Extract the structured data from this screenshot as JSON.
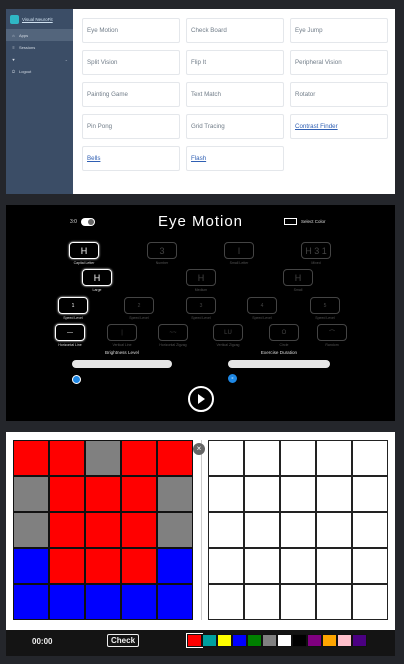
{
  "menu": {
    "app_name": "Visual NeuroFit",
    "nav": [
      {
        "label": "Apps",
        "icon": "home-icon"
      },
      {
        "label": "Sessions",
        "icon": "list-icon"
      },
      {
        "label": "",
        "icon": "heart-icon",
        "chevron": true
      },
      {
        "label": "Logout",
        "icon": "logout-icon"
      }
    ],
    "tiles": [
      {
        "label": "Eye Motion",
        "link": false
      },
      {
        "label": "Check Board",
        "link": false
      },
      {
        "label": "Eye Jump",
        "link": false
      },
      {
        "label": "Split Vision",
        "link": false
      },
      {
        "label": "Flip It",
        "link": false
      },
      {
        "label": "Peripheral Vision",
        "link": false
      },
      {
        "label": "Painting Game",
        "link": false
      },
      {
        "label": "Text Match",
        "link": false
      },
      {
        "label": "Rotator",
        "link": false
      },
      {
        "label": "Pin Pong",
        "link": false
      },
      {
        "label": "Grid Tracing",
        "link": false
      },
      {
        "label": "Contrast Finder",
        "link": true
      },
      {
        "label": "Bells",
        "link": true
      },
      {
        "label": "Flash",
        "link": true
      }
    ]
  },
  "eye_motion": {
    "title": "Eye Motion",
    "toggle_label": "3:0",
    "select_color_label": "Select Color",
    "type_options": [
      {
        "text": "H",
        "caption": "Capital Letter",
        "selected": true
      },
      {
        "text": "3",
        "caption": "Number",
        "selected": false
      },
      {
        "text": "l",
        "caption": "Small Letter",
        "selected": false
      },
      {
        "text": "H 3 1",
        "caption": "Mixed",
        "selected": false
      }
    ],
    "size_options": [
      {
        "text": "H",
        "caption": "Large",
        "selected": true
      },
      {
        "text": "H",
        "caption": "Medium",
        "selected": false
      },
      {
        "text": "H",
        "caption": "Small",
        "selected": false
      }
    ],
    "speed_options": [
      {
        "text": "1",
        "caption": "Speed Level",
        "selected": true
      },
      {
        "text": "2",
        "caption": "Speed Level",
        "selected": false
      },
      {
        "text": "3",
        "caption": "Speed Level",
        "selected": false
      },
      {
        "text": "4",
        "caption": "Speed Level",
        "selected": false
      },
      {
        "text": "5",
        "caption": "Speed Level",
        "selected": false
      }
    ],
    "direction_options": [
      {
        "text": "—",
        "caption": "Horizontal Line",
        "selected": true
      },
      {
        "text": "|",
        "caption": "Vertical Line",
        "selected": false
      },
      {
        "text": "~~",
        "caption": "Horizontal Zigzag",
        "selected": false
      },
      {
        "text": "LU",
        "caption": "Vertical Zigzag",
        "selected": false
      },
      {
        "text": "O",
        "caption": "Circle",
        "selected": false
      },
      {
        "text": "⌒",
        "caption": "Random",
        "selected": false
      }
    ],
    "brightness": {
      "label": "Brightness Level",
      "value": 0.0
    },
    "duration": {
      "label": "Exercise Duration",
      "value": 0.0,
      "thumb_text": "0"
    }
  },
  "grid_game": {
    "timer": "00:00",
    "check_label": "Check",
    "close_symbol": "×",
    "left_grid": [
      [
        "red",
        "red",
        "gray",
        "red",
        "red"
      ],
      [
        "gray",
        "red",
        "red",
        "red",
        "gray"
      ],
      [
        "gray",
        "red",
        "red",
        "red",
        "gray"
      ],
      [
        "blue",
        "red",
        "red",
        "red",
        "blue"
      ],
      [
        "blue",
        "blue",
        "blue",
        "blue",
        "blue"
      ]
    ],
    "colors": {
      "red": "#ff0000",
      "gray": "#808080",
      "blue": "#0000ff",
      "white": "#ffffff"
    },
    "palette": [
      "#ff0000",
      "#00a0a0",
      "#ffff00",
      "#0000ff",
      "#008000",
      "#808080",
      "#ffffff",
      "#000000",
      "#800080",
      "#ffa500",
      "#ffc0cb",
      "#4b0082"
    ]
  }
}
